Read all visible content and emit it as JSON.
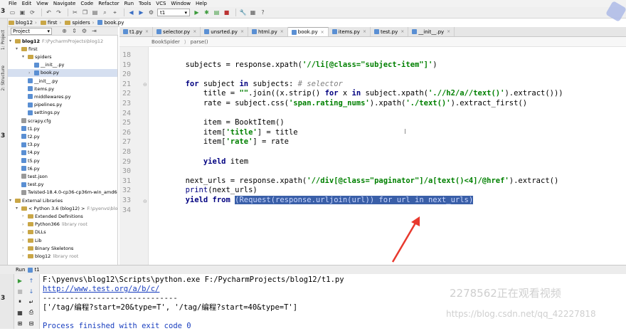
{
  "menu": [
    "File",
    "Edit",
    "View",
    "Navigate",
    "Code",
    "Refactor",
    "Run",
    "Tools",
    "VCS",
    "Window",
    "Help"
  ],
  "toolbar": {
    "run_config": "t1"
  },
  "nav": {
    "crumbs": [
      "blog12",
      "first",
      "spiders",
      "book.py"
    ]
  },
  "left_stripe": {
    "tabs": [
      "1: Project",
      "2: Structure"
    ]
  },
  "project_panel": {
    "selector": "Project",
    "tree": [
      {
        "text": "blog12",
        "hint": "F:\\PycharmProjects\\blog12",
        "icon": "folder",
        "indent": 0,
        "arrow": "▾",
        "bold": true
      },
      {
        "text": "first",
        "hint": "",
        "icon": "folder",
        "indent": 1,
        "arrow": "▾"
      },
      {
        "text": "spiders",
        "hint": "",
        "icon": "folder",
        "indent": 2,
        "arrow": "▾"
      },
      {
        "text": "__init__.py",
        "hint": "",
        "icon": "py",
        "indent": 3,
        "arrow": ""
      },
      {
        "text": "book.py",
        "hint": "",
        "icon": "py",
        "indent": 3,
        "arrow": "›",
        "selected": true
      },
      {
        "text": "__init__.py",
        "hint": "",
        "icon": "py",
        "indent": 2,
        "arrow": ""
      },
      {
        "text": "items.py",
        "hint": "",
        "icon": "py",
        "indent": 2,
        "arrow": ""
      },
      {
        "text": "middlewares.py",
        "hint": "",
        "icon": "py",
        "indent": 2,
        "arrow": ""
      },
      {
        "text": "pipelines.py",
        "hint": "",
        "icon": "py",
        "indent": 2,
        "arrow": ""
      },
      {
        "text": "settings.py",
        "hint": "",
        "icon": "py",
        "indent": 2,
        "arrow": ""
      },
      {
        "text": "scrapy.cfg",
        "hint": "",
        "icon": "cfg",
        "indent": 1,
        "arrow": ""
      },
      {
        "text": "t1.py",
        "hint": "",
        "icon": "py",
        "indent": 1,
        "arrow": ""
      },
      {
        "text": "t2.py",
        "hint": "",
        "icon": "py",
        "indent": 1,
        "arrow": ""
      },
      {
        "text": "t3.py",
        "hint": "",
        "icon": "py",
        "indent": 1,
        "arrow": ""
      },
      {
        "text": "t4.py",
        "hint": "",
        "icon": "py",
        "indent": 1,
        "arrow": ""
      },
      {
        "text": "t5.py",
        "hint": "",
        "icon": "py",
        "indent": 1,
        "arrow": ""
      },
      {
        "text": "t6.py",
        "hint": "",
        "icon": "py",
        "indent": 1,
        "arrow": ""
      },
      {
        "text": "test.json",
        "hint": "",
        "icon": "cfg",
        "indent": 1,
        "arrow": ""
      },
      {
        "text": "test.py",
        "hint": "",
        "icon": "py",
        "indent": 1,
        "arrow": ""
      },
      {
        "text": "Twisted-18.4.0-cp36-cp36m-win_amd64.whl",
        "hint": "",
        "icon": "cfg",
        "indent": 1,
        "arrow": ""
      },
      {
        "text": "External Libraries",
        "hint": "",
        "icon": "folder",
        "indent": 0,
        "arrow": "▾"
      },
      {
        "text": "< Python 3.6 (blog12) >",
        "hint": "F:\\pyenvs\\blog12\\",
        "icon": "folder",
        "indent": 1,
        "arrow": "▾"
      },
      {
        "text": "Extended Definitions",
        "hint": "",
        "icon": "folder",
        "indent": 2,
        "arrow": "›"
      },
      {
        "text": "Python366",
        "hint": "library root",
        "icon": "folder",
        "indent": 2,
        "arrow": "›"
      },
      {
        "text": "DLLs",
        "hint": "",
        "icon": "folder",
        "indent": 2,
        "arrow": "›"
      },
      {
        "text": "Lib",
        "hint": "",
        "icon": "folder",
        "indent": 2,
        "arrow": "›"
      },
      {
        "text": "Binary Skeletons",
        "hint": "",
        "icon": "folder",
        "indent": 2,
        "arrow": "›"
      },
      {
        "text": "blog12",
        "hint": "library root",
        "icon": "folder",
        "indent": 2,
        "arrow": "›"
      }
    ]
  },
  "tabs": [
    {
      "label": "t1.py",
      "active": false
    },
    {
      "label": "selector.py",
      "active": false
    },
    {
      "label": "unsrted.py",
      "active": false
    },
    {
      "label": "html.py",
      "active": false
    },
    {
      "label": "book.py",
      "active": true
    },
    {
      "label": "items.py",
      "active": false
    },
    {
      "label": "test.py",
      "active": false
    },
    {
      "label": "__init__.py",
      "active": false
    }
  ],
  "editor": {
    "breadcrumb": [
      "BookSpider",
      "parse()"
    ],
    "line_numbers": [
      "18",
      "19",
      "20",
      "21",
      "22",
      "23",
      "24",
      "25",
      "26",
      "27",
      "28",
      "29",
      "30",
      "31",
      "32",
      "33",
      "34"
    ],
    "lines": [
      [],
      [
        [
          "t",
          "        subjects = response.xpath("
        ],
        [
          "s",
          "'//li[@class=\"subject-item\"]'"
        ],
        [
          "t",
          ")"
        ]
      ],
      [],
      [
        [
          "t",
          "        "
        ],
        [
          "k",
          "for"
        ],
        [
          "t",
          " subject "
        ],
        [
          "k",
          "in"
        ],
        [
          "t",
          " subjects: "
        ],
        [
          "c",
          "# selector"
        ]
      ],
      [
        [
          "t",
          "            title = "
        ],
        [
          "s",
          "\"\""
        ],
        [
          "t",
          ".join((x.strip() "
        ],
        [
          "k",
          "for"
        ],
        [
          "t",
          " x "
        ],
        [
          "k",
          "in"
        ],
        [
          "t",
          " subject.xpath("
        ],
        [
          "s",
          "'.//h2/a//text()'"
        ],
        [
          "t",
          ").extract()))"
        ]
      ],
      [
        [
          "t",
          "            rate = subject.css("
        ],
        [
          "s",
          "'span.rating_nums'"
        ],
        [
          "t",
          ").xpath("
        ],
        [
          "s",
          "'./text()'"
        ],
        [
          "t",
          ").extract_first()"
        ]
      ],
      [],
      [
        [
          "t",
          "            item = BooktItem()"
        ]
      ],
      [
        [
          "t",
          "            item["
        ],
        [
          "s",
          "'title'"
        ],
        [
          "t",
          "] = title"
        ]
      ],
      [
        [
          "t",
          "            item["
        ],
        [
          "s",
          "'rate'"
        ],
        [
          "t",
          "] = rate"
        ]
      ],
      [],
      [
        [
          "t",
          "            "
        ],
        [
          "k",
          "yield"
        ],
        [
          "t",
          " item"
        ]
      ],
      [],
      [
        [
          "t",
          "        next_urls = response.xpath("
        ],
        [
          "s",
          "'//div[@class=\"paginator\"]/a[text()<4]/@href'"
        ],
        [
          "t",
          ").extract()"
        ]
      ],
      [
        [
          "t",
          "        "
        ],
        [
          "f",
          "print"
        ],
        [
          "t",
          "(next_urls)"
        ]
      ],
      [
        [
          "t",
          "        "
        ],
        [
          "k",
          "yield"
        ],
        [
          "t",
          " "
        ],
        [
          "k",
          "from"
        ],
        [
          "t",
          " "
        ],
        [
          "h",
          "(Request(response.urljoin(url)) for url in next_urls)"
        ]
      ],
      []
    ]
  },
  "run_panel": {
    "title": "Run",
    "config": "t1",
    "output": [
      "F:\\pyenvs\\blog12\\Scripts\\python.exe F:/PycharmProjects/blog12/t1.py",
      "http://www.test.org/a/b/c/",
      "------------------------------",
      "['/tag/编程?start=20&type=T', '/tag/编程?start=40&type=T']",
      "",
      "Process finished with exit code 0"
    ]
  },
  "watermark": {
    "viewers": "2278562正在观看视频",
    "url": "https://blog.csdn.net/qq_42227818"
  },
  "colors": {
    "accent_highlight": "#3a5fa8",
    "keyword": "#000080",
    "string": "#008000",
    "arrow": "#e8392e"
  }
}
